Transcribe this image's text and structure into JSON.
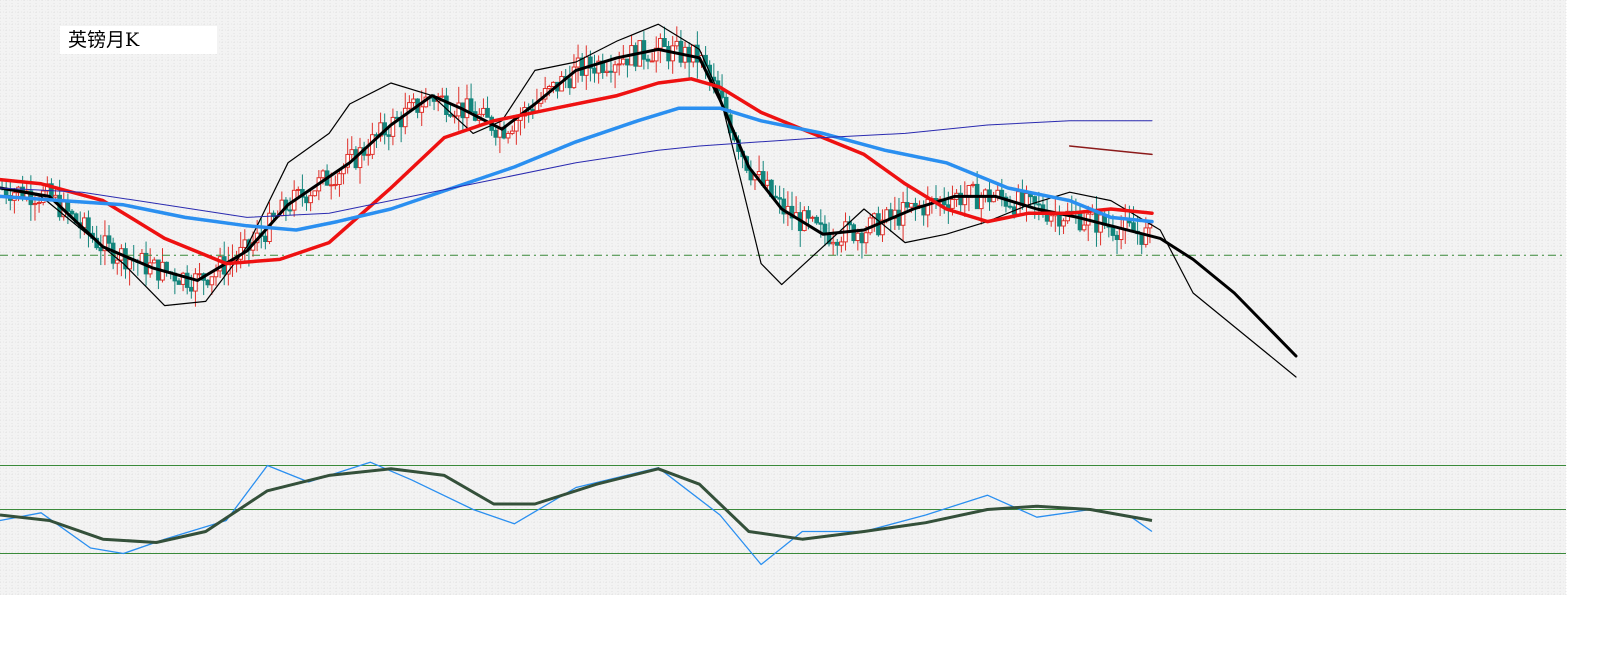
{
  "header": {
    "title": "英镑月K"
  },
  "chart_data": {
    "type": "line",
    "title": "英镑月K",
    "xlabel": "",
    "ylabel": "",
    "xlim": [
      0,
      315
    ],
    "ylim": [
      0,
      1
    ],
    "grid": true,
    "colors": {
      "up_candle": "#e0302a",
      "down_candle": "#13857c",
      "ma_fast": "#000000",
      "ma_mid": "#000000",
      "ma_red": "#ee1111",
      "ma_blue": "#2a8ff0",
      "ma_navy": "#2a2ab0",
      "ma_maroon": "#8b1a1a",
      "level_line": "#3a8a3a",
      "osc_blue": "#2a8ff0",
      "osc_dark": "#34503a",
      "osc_level": "#3a8a3a"
    },
    "price_series": [
      {
        "color_key": "ma_fast",
        "width": 1.2,
        "points": [
          [
            0,
            0.6
          ],
          [
            10,
            0.58
          ],
          [
            20,
            0.5
          ],
          [
            30,
            0.42
          ],
          [
            40,
            0.32
          ],
          [
            50,
            0.33
          ],
          [
            60,
            0.46
          ],
          [
            70,
            0.66
          ],
          [
            80,
            0.73
          ],
          [
            85,
            0.8
          ],
          [
            95,
            0.85
          ],
          [
            105,
            0.82
          ],
          [
            115,
            0.73
          ],
          [
            122,
            0.76
          ],
          [
            130,
            0.88
          ],
          [
            140,
            0.9
          ],
          [
            150,
            0.95
          ],
          [
            160,
            0.99
          ],
          [
            170,
            0.93
          ],
          [
            175,
            0.82
          ],
          [
            180,
            0.62
          ],
          [
            185,
            0.42
          ],
          [
            190,
            0.37
          ],
          [
            200,
            0.46
          ],
          [
            210,
            0.55
          ],
          [
            220,
            0.47
          ],
          [
            230,
            0.49
          ],
          [
            240,
            0.52
          ],
          [
            250,
            0.56
          ],
          [
            260,
            0.59
          ],
          [
            270,
            0.57
          ],
          [
            282,
            0.5
          ],
          [
            290,
            0.35
          ],
          [
            300,
            0.27
          ],
          [
            315,
            0.15
          ]
        ]
      },
      {
        "color_key": "ma_mid",
        "width": 3,
        "points": [
          [
            0,
            0.6
          ],
          [
            12,
            0.58
          ],
          [
            25,
            0.46
          ],
          [
            37,
            0.41
          ],
          [
            48,
            0.38
          ],
          [
            60,
            0.45
          ],
          [
            70,
            0.56
          ],
          [
            85,
            0.66
          ],
          [
            95,
            0.75
          ],
          [
            105,
            0.82
          ],
          [
            112,
            0.79
          ],
          [
            122,
            0.74
          ],
          [
            130,
            0.8
          ],
          [
            140,
            0.88
          ],
          [
            150,
            0.91
          ],
          [
            160,
            0.93
          ],
          [
            170,
            0.91
          ],
          [
            175,
            0.81
          ],
          [
            182,
            0.65
          ],
          [
            190,
            0.55
          ],
          [
            200,
            0.49
          ],
          [
            210,
            0.5
          ],
          [
            222,
            0.55
          ],
          [
            232,
            0.58
          ],
          [
            242,
            0.58
          ],
          [
            252,
            0.55
          ],
          [
            262,
            0.53
          ],
          [
            270,
            0.51
          ],
          [
            282,
            0.48
          ],
          [
            290,
            0.43
          ],
          [
            300,
            0.35
          ],
          [
            315,
            0.2
          ]
        ]
      },
      {
        "color_key": "ma_red",
        "width": 3.5,
        "points": [
          [
            0,
            0.62
          ],
          [
            10,
            0.61
          ],
          [
            25,
            0.57
          ],
          [
            40,
            0.48
          ],
          [
            55,
            0.42
          ],
          [
            68,
            0.43
          ],
          [
            80,
            0.47
          ],
          [
            95,
            0.6
          ],
          [
            108,
            0.72
          ],
          [
            120,
            0.76
          ],
          [
            135,
            0.79
          ],
          [
            150,
            0.82
          ],
          [
            160,
            0.85
          ],
          [
            168,
            0.86
          ],
          [
            175,
            0.84
          ],
          [
            185,
            0.78
          ],
          [
            200,
            0.72
          ],
          [
            210,
            0.68
          ],
          [
            220,
            0.61
          ],
          [
            230,
            0.55
          ],
          [
            240,
            0.52
          ],
          [
            250,
            0.54
          ],
          [
            260,
            0.54
          ],
          [
            270,
            0.55
          ],
          [
            280,
            0.54
          ]
        ]
      },
      {
        "color_key": "ma_blue",
        "width": 3.5,
        "points": [
          [
            0,
            0.58
          ],
          [
            15,
            0.57
          ],
          [
            30,
            0.56
          ],
          [
            45,
            0.53
          ],
          [
            60,
            0.51
          ],
          [
            72,
            0.5
          ],
          [
            82,
            0.52
          ],
          [
            95,
            0.55
          ],
          [
            110,
            0.6
          ],
          [
            125,
            0.65
          ],
          [
            140,
            0.71
          ],
          [
            155,
            0.76
          ],
          [
            165,
            0.79
          ],
          [
            175,
            0.79
          ],
          [
            185,
            0.76
          ],
          [
            200,
            0.73
          ],
          [
            215,
            0.69
          ],
          [
            230,
            0.66
          ],
          [
            245,
            0.6
          ],
          [
            260,
            0.57
          ],
          [
            270,
            0.53
          ],
          [
            280,
            0.52
          ]
        ]
      },
      {
        "color_key": "ma_navy",
        "width": 1,
        "points": [
          [
            0,
            0.6
          ],
          [
            20,
            0.59
          ],
          [
            40,
            0.56
          ],
          [
            60,
            0.53
          ],
          [
            80,
            0.54
          ],
          [
            100,
            0.58
          ],
          [
            120,
            0.62
          ],
          [
            140,
            0.66
          ],
          [
            160,
            0.69
          ],
          [
            170,
            0.7
          ],
          [
            185,
            0.71
          ],
          [
            200,
            0.72
          ],
          [
            220,
            0.73
          ],
          [
            240,
            0.75
          ],
          [
            260,
            0.76
          ],
          [
            280,
            0.76
          ]
        ]
      },
      {
        "color_key": "ma_maroon",
        "width": 1.5,
        "points": [
          [
            260,
            0.7
          ],
          [
            270,
            0.69
          ],
          [
            280,
            0.68
          ]
        ]
      }
    ],
    "level_y": 0.44,
    "osc_series": [
      {
        "color_key": "osc_blue",
        "width": 1.3,
        "points": [
          [
            0,
            0.45
          ],
          [
            10,
            0.52
          ],
          [
            22,
            0.2
          ],
          [
            30,
            0.15
          ],
          [
            40,
            0.28
          ],
          [
            55,
            0.45
          ],
          [
            65,
            0.95
          ],
          [
            75,
            0.8
          ],
          [
            90,
            0.98
          ],
          [
            100,
            0.82
          ],
          [
            115,
            0.55
          ],
          [
            125,
            0.42
          ],
          [
            140,
            0.75
          ],
          [
            160,
            0.93
          ],
          [
            175,
            0.5
          ],
          [
            185,
            0.05
          ],
          [
            195,
            0.35
          ],
          [
            210,
            0.35
          ],
          [
            225,
            0.5
          ],
          [
            240,
            0.68
          ],
          [
            252,
            0.48
          ],
          [
            265,
            0.55
          ],
          [
            275,
            0.48
          ],
          [
            280,
            0.35
          ]
        ]
      },
      {
        "color_key": "osc_dark",
        "width": 3,
        "points": [
          [
            0,
            0.5
          ],
          [
            12,
            0.45
          ],
          [
            25,
            0.28
          ],
          [
            38,
            0.25
          ],
          [
            50,
            0.35
          ],
          [
            65,
            0.72
          ],
          [
            80,
            0.86
          ],
          [
            95,
            0.92
          ],
          [
            108,
            0.86
          ],
          [
            120,
            0.6
          ],
          [
            130,
            0.6
          ],
          [
            145,
            0.78
          ],
          [
            160,
            0.92
          ],
          [
            170,
            0.78
          ],
          [
            182,
            0.35
          ],
          [
            195,
            0.28
          ],
          [
            210,
            0.35
          ],
          [
            225,
            0.43
          ],
          [
            240,
            0.55
          ],
          [
            252,
            0.58
          ],
          [
            265,
            0.55
          ],
          [
            280,
            0.45
          ]
        ]
      }
    ],
    "osc_levels": [
      0.95,
      0.55,
      0.15
    ]
  }
}
